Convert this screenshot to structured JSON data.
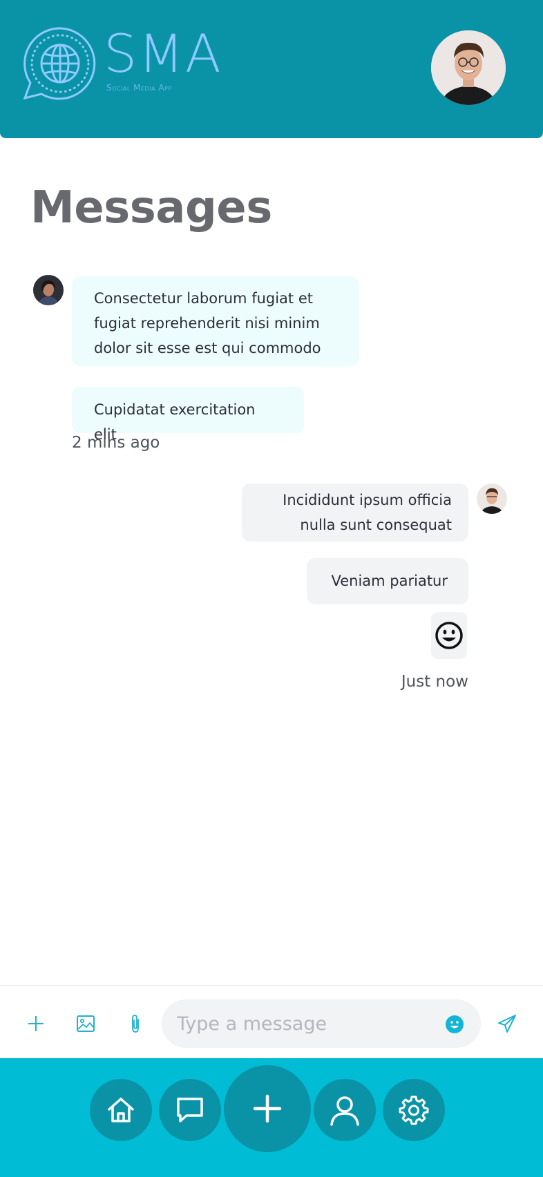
{
  "app": {
    "logo_text": "SMA",
    "logo_subtitle": "Social Media App"
  },
  "colors": {
    "header": "#0a93a6",
    "accent": "#00bcd4",
    "incoming_bubble": "#edfcfd",
    "outgoing_bubble": "#f2f3f5",
    "logo": "#8ec9ff"
  },
  "header": {
    "avatar_icon": "user-avatar"
  },
  "page": {
    "title": "Messages"
  },
  "conversation": {
    "incoming": {
      "messages": [
        "Consectetur laborum fugiat et fugiat reprehenderit nisi minim dolor sit esse est qui commodo duis irure dolor",
        "Cupidatat exercitation elit"
      ],
      "timestamp": "2 mins ago"
    },
    "outgoing": {
      "messages": [
        "Incididunt ipsum officia nulla sunt consequat",
        "Veniam pariatur"
      ],
      "emoji": "😀",
      "timestamp": "Just now"
    }
  },
  "composer": {
    "placeholder": "Type a message",
    "value": "",
    "icons": [
      "plus-icon",
      "image-icon",
      "paperclip-icon",
      "emoji-icon",
      "send-icon"
    ]
  },
  "bottom_nav": {
    "items": [
      "home-icon",
      "chat-icon",
      "add-icon",
      "user-icon",
      "settings-icon"
    ]
  }
}
